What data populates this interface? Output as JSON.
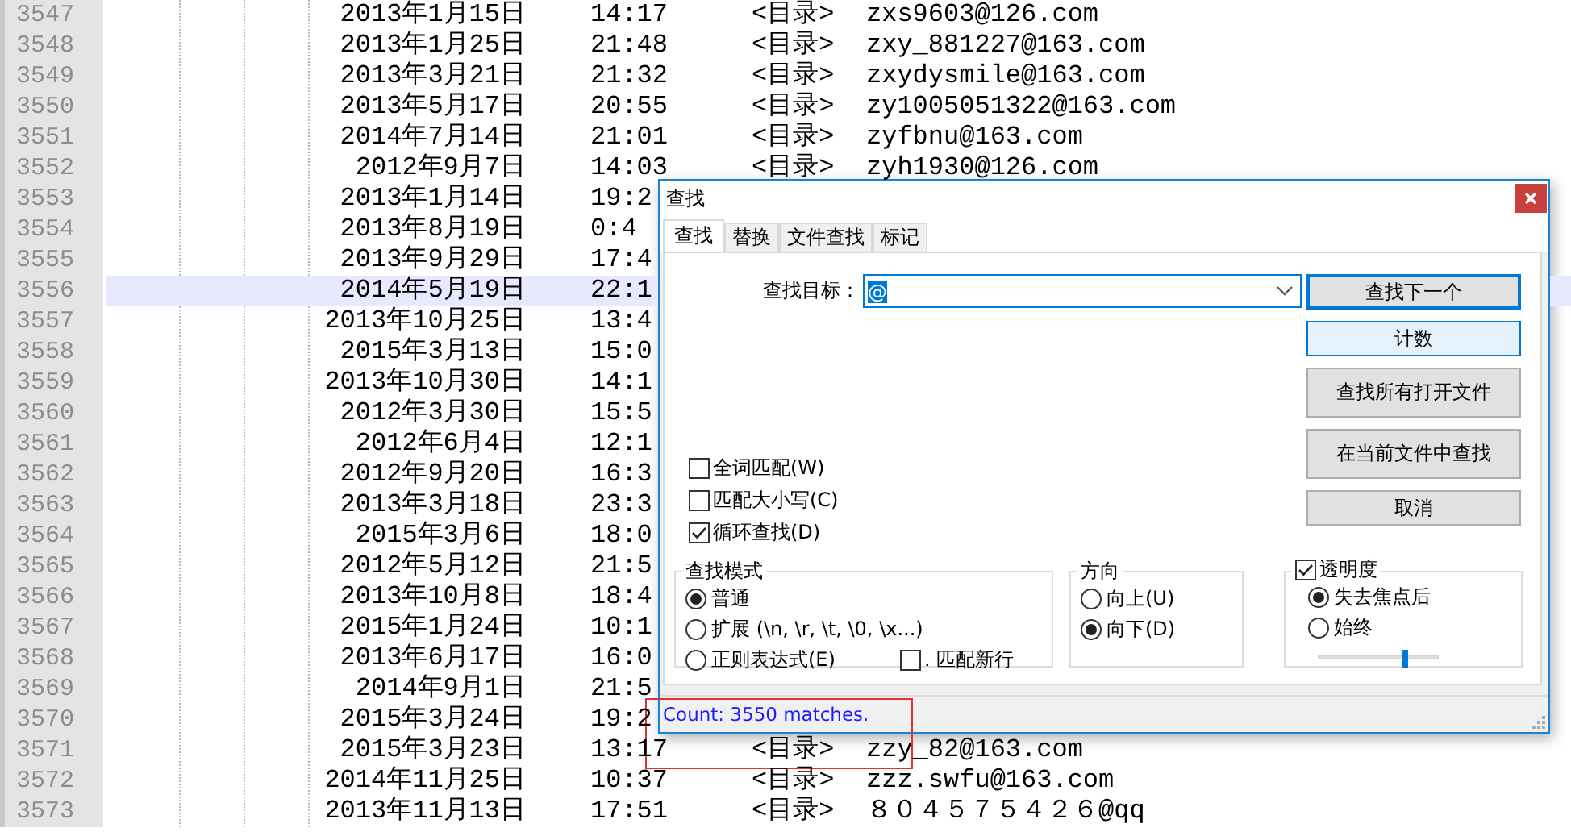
{
  "editor": {
    "lines": [
      {
        "number": "3547",
        "date": "2013年1月15日",
        "time": "14:17",
        "tag": "<目录>",
        "email": "zxs9603@126.com",
        "current": false
      },
      {
        "number": "3548",
        "date": "2013年1月25日",
        "time": "21:48",
        "tag": "<目录>",
        "email": "zxy_881227@163.com",
        "current": false
      },
      {
        "number": "3549",
        "date": "2013年3月21日",
        "time": "21:32",
        "tag": "<目录>",
        "email": "zxydysmile@163.com",
        "current": false
      },
      {
        "number": "3550",
        "date": "2013年5月17日",
        "time": "20:55",
        "tag": "<目录>",
        "email": "zy1005051322@163.com",
        "current": false
      },
      {
        "number": "3551",
        "date": "2014年7月14日",
        "time": "21:01",
        "tag": "<目录>",
        "email": "zyfbnu@163.com",
        "current": false
      },
      {
        "number": "3552",
        "date": "2012年9月7日",
        "time": "14:03",
        "tag": "<目录>",
        "email": "zyh1930@126.com",
        "current": false
      },
      {
        "number": "3553",
        "date": "2013年1月14日",
        "time": "19:2",
        "current": false
      },
      {
        "number": "3554",
        "date": "2013年8月19日",
        "time": "0:4",
        "current": false
      },
      {
        "number": "3555",
        "date": "2013年9月29日",
        "time": "17:4",
        "current": false
      },
      {
        "number": "3556",
        "date": "2014年5月19日",
        "time": "22:1",
        "current": true
      },
      {
        "number": "3557",
        "date": "2013年10月25日",
        "time": "13:4",
        "current": false
      },
      {
        "number": "3558",
        "date": "2015年3月13日",
        "time": "15:0",
        "current": false
      },
      {
        "number": "3559",
        "date": "2013年10月30日",
        "time": "14:1",
        "current": false
      },
      {
        "number": "3560",
        "date": "2012年3月30日",
        "time": "15:5",
        "current": false
      },
      {
        "number": "3561",
        "date": "2012年6月4日",
        "time": "12:1",
        "current": false
      },
      {
        "number": "3562",
        "date": "2012年9月20日",
        "time": "16:3",
        "current": false
      },
      {
        "number": "3563",
        "date": "2013年3月18日",
        "time": "23:3",
        "current": false
      },
      {
        "number": "3564",
        "date": "2015年3月6日",
        "time": "18:0",
        "current": false
      },
      {
        "number": "3565",
        "date": "2012年5月12日",
        "time": "21:5",
        "current": false
      },
      {
        "number": "3566",
        "date": "2013年10月8日",
        "time": "18:4",
        "current": false
      },
      {
        "number": "3567",
        "date": "2015年1月24日",
        "time": "10:1",
        "current": false
      },
      {
        "number": "3568",
        "date": "2013年6月17日",
        "time": "16:0",
        "current": false
      },
      {
        "number": "3569",
        "date": "2014年9月1日",
        "time": "21:5",
        "current": false
      },
      {
        "number": "3570",
        "date": "2015年3月24日",
        "time": "19:2",
        "current": false
      },
      {
        "number": "3571",
        "date": "2015年3月23日",
        "time": "13:17",
        "tag": "<目录>",
        "email": "zzy_82@163.com",
        "current": false
      },
      {
        "number": "3572",
        "date": "2014年11月25日",
        "time": "10:37",
        "tag": "<目录>",
        "email": "zzz.swfu@163.com",
        "current": false
      },
      {
        "number": "3573",
        "date": "2013年11月13日",
        "time": "17:51",
        "tag": "<目录>",
        "email": "８０４５７５４２６@qq",
        "current": false
      }
    ]
  },
  "find_dialog": {
    "title": "查找",
    "tabs": [
      {
        "label": "查找",
        "selected": true
      },
      {
        "label": "替换",
        "selected": false
      },
      {
        "label": "文件查找",
        "selected": false
      },
      {
        "label": "标记",
        "selected": false
      }
    ],
    "target_label": "查找目标：",
    "target_value": "@",
    "buttons": [
      {
        "label": "查找下一个",
        "kind": "default"
      },
      {
        "label": "计数",
        "kind": "focused"
      },
      {
        "label": "查找所有打开文件",
        "kind": "tall"
      },
      {
        "label": "在当前文件中查找",
        "kind": "tall"
      },
      {
        "label": "取消",
        "kind": "normal"
      }
    ],
    "options": [
      {
        "label": "全词匹配(W)",
        "checked": false
      },
      {
        "label": "匹配大小写(C)",
        "checked": false
      },
      {
        "label": "循环查找(D)",
        "checked": true
      }
    ],
    "search_mode": {
      "title": "查找模式",
      "options": [
        {
          "label": "普通",
          "selected": true
        },
        {
          "label": "扩展 (\\n, \\r, \\t, \\0, \\x...)",
          "selected": false
        },
        {
          "label": "正则表达式(E)",
          "selected": false
        }
      ],
      "dot_newline": {
        "label": ". 匹配新行",
        "checked": false
      }
    },
    "direction": {
      "title": "方向",
      "options": [
        {
          "label": "向上(U)",
          "selected": false
        },
        {
          "label": "向下(D)",
          "selected": true
        }
      ]
    },
    "transparency": {
      "label": "透明度",
      "checked": true,
      "options": [
        {
          "label": "失去焦点后",
          "selected": true
        },
        {
          "label": "始终",
          "selected": false
        }
      ],
      "level": 0.72
    },
    "status": "Count: 3550 matches."
  },
  "annotation_frame": true
}
